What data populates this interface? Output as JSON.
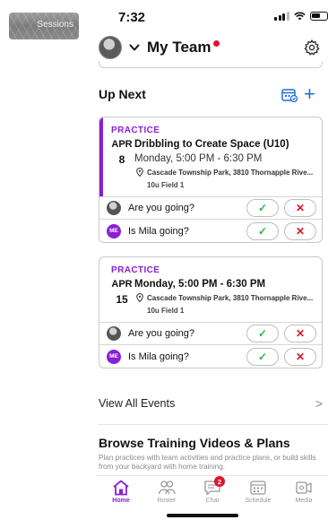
{
  "thumbnail": {
    "label": "Sessions"
  },
  "status_bar": {
    "time": "7:32"
  },
  "header": {
    "team_name": "My Team"
  },
  "up_next": {
    "title": "Up Next",
    "events": [
      {
        "type": "PRACTICE",
        "month": "APR",
        "day": "8",
        "title": "Dribbling to Create Space (U10)",
        "time": "Monday, 5:00 PM - 6:30 PM",
        "location": "Cascade Township Park, 3810 Thornapple Rive...",
        "field": "10u Field 1",
        "rsvps": [
          {
            "avatar_text": "",
            "question": "Are you going?"
          },
          {
            "avatar_text": "ME",
            "question": "Is Mila going?"
          }
        ]
      },
      {
        "type": "PRACTICE",
        "month": "APR",
        "day": "15",
        "title": "",
        "time": "Monday, 5:00 PM - 6:30 PM",
        "location": "Cascade Township Park, 3810 Thornapple Rive...",
        "field": "10u Field 1",
        "rsvps": [
          {
            "avatar_text": "",
            "question": "Are you going?"
          },
          {
            "avatar_text": "ME",
            "question": "Is Mila going?"
          }
        ]
      }
    ],
    "yes_glyph": "✓",
    "no_glyph": "✕"
  },
  "view_all": {
    "label": "View All Events",
    "arrow": ">"
  },
  "browse": {
    "title": "Browse Training Videos & Plans",
    "description": "Plan practices with team activities and practice plans, or build skills from your backyard with home training."
  },
  "tabs": [
    {
      "label": "Home",
      "active": true
    },
    {
      "label": "Roster"
    },
    {
      "label": "Chat",
      "badge": "2"
    },
    {
      "label": "Schedule"
    },
    {
      "label": "Media"
    }
  ],
  "colors": {
    "accent": "#8a1fd6",
    "blue": "#1f6fd6",
    "alert": "#e0142d",
    "yes": "#2fb344"
  }
}
